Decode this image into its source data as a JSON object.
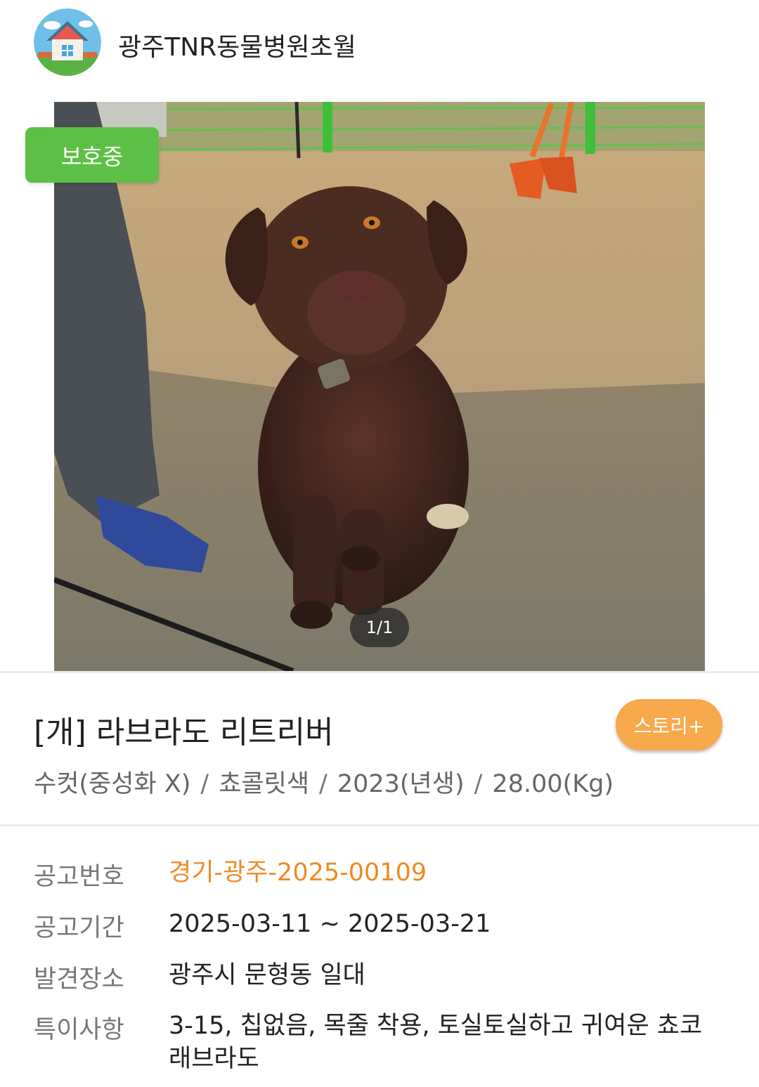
{
  "header": {
    "shelter_name": "광주TNR동물병원초월",
    "avatar_icon": "house-icon"
  },
  "photo": {
    "status_badge": "보호중",
    "counter": "1/1"
  },
  "animal": {
    "title": "[개] 라브라도 리트리버",
    "story_button": "스토리+",
    "sex": "수컷(중성화 X)",
    "color": "쵸콜릿색",
    "birth": "2023(년생)",
    "weight": "28.00(Kg)",
    "separator": "/"
  },
  "details": {
    "notice_no_label": "공고번호",
    "notice_no": "경기-광주-2025-00109",
    "period_label": "공고기간",
    "period": "2025-03-11 ~ 2025-03-21",
    "found_place_label": "발견장소",
    "found_place": "광주시 문형동 일대",
    "remarks_label": "특이사항",
    "remarks": "3-15, 칩없음, 목줄 착용, 토실토실하고 귀여운 쵸코 래브라도"
  },
  "colors": {
    "accent_orange": "#f08a24",
    "badge_green": "#5cc046",
    "story_orange": "#f7a94b"
  }
}
